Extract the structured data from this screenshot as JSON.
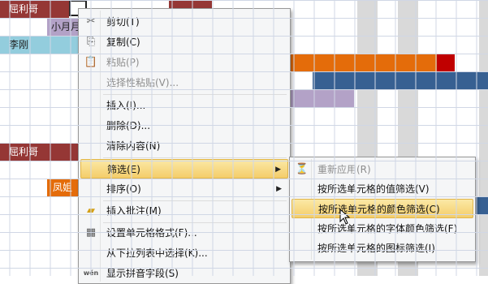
{
  "sheet": {
    "colors": {
      "brown": "#953735",
      "lavender": "#b3a2c7",
      "lightblue": "#93cddd",
      "orange": "#e46c0a",
      "blue": "#376092",
      "red": "#c00000",
      "gray": "#d9d9d9"
    },
    "cells": {
      "brown_top": "屈利哥",
      "lavender_row2": "小月月",
      "lightblue_row3": "李刚",
      "brown_row8": "屈利哥",
      "orange_row10": "凤姐"
    }
  },
  "context_menu": {
    "items": [
      {
        "label": "剪切(T)",
        "icon": "scissors-icon",
        "enabled": true
      },
      {
        "label": "复制(C)",
        "icon": "copy-icon",
        "enabled": true
      },
      {
        "label": "粘贴(P)",
        "icon": "paste-icon",
        "enabled": false
      },
      {
        "label": "选择性粘贴(V)...",
        "icon": "",
        "enabled": false
      },
      {
        "label": "插入(I)...",
        "icon": "",
        "enabled": true
      },
      {
        "label": "删除(D)...",
        "icon": "",
        "enabled": true
      },
      {
        "label": "清除内容(N)",
        "icon": "",
        "enabled": true
      },
      {
        "label": "筛选(E)",
        "icon": "",
        "enabled": true,
        "submenu": true,
        "highlighted": true
      },
      {
        "label": "排序(O)",
        "icon": "",
        "enabled": true,
        "submenu": true
      },
      {
        "label": "插入批注(M)",
        "icon": "comment-icon",
        "enabled": true
      },
      {
        "label": "设置单元格格式(F)...",
        "icon": "format-cells-icon",
        "enabled": true
      },
      {
        "label": "从下拉列表中选择(K)...",
        "icon": "",
        "enabled": true
      },
      {
        "label": "显示拼音字段(S)",
        "icon": "phonetic-icon",
        "enabled": true
      }
    ]
  },
  "filter_submenu": {
    "items": [
      {
        "label": "重新应用(R)",
        "icon": "reapply-filter-icon",
        "enabled": false
      },
      {
        "label": "按所选单元格的值筛选(V)",
        "enabled": true
      },
      {
        "label": "按所选单元格的颜色筛选(C)",
        "enabled": true,
        "highlighted": true
      },
      {
        "label": "按所选单元格的字体颜色筛选(F)",
        "enabled": true
      },
      {
        "label": "按所选单元格的图标筛选(I)",
        "enabled": true
      }
    ]
  }
}
